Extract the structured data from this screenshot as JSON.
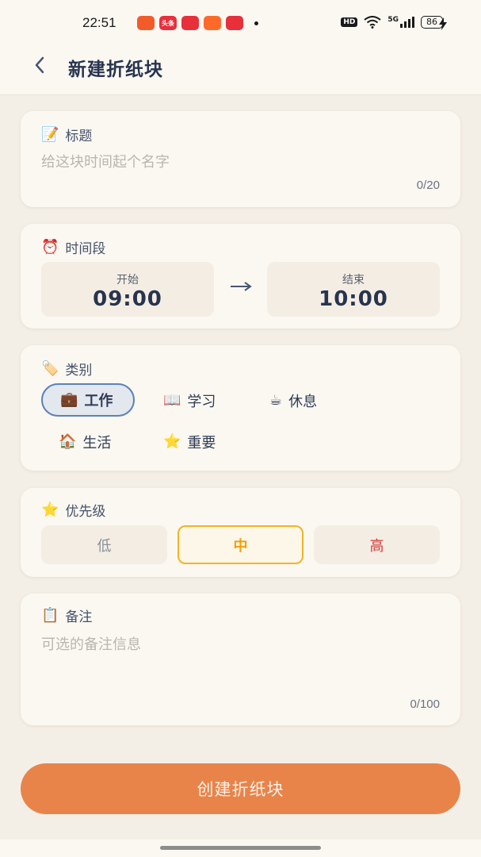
{
  "status_bar": {
    "time": "22:51",
    "app_icons": [
      {
        "name": "app-icon-1",
        "color": "#f25c2a"
      },
      {
        "name": "app-icon-toutiao",
        "color": "#e8303b",
        "text": "头条"
      },
      {
        "name": "app-icon-3",
        "color": "#e8303b"
      },
      {
        "name": "app-icon-4",
        "color": "#ff6a2b"
      },
      {
        "name": "app-icon-music",
        "color": "#e8303b"
      }
    ],
    "hd": "HD",
    "network": "5G",
    "battery": "86"
  },
  "header": {
    "title": "新建折纸块"
  },
  "title_section": {
    "icon": "📝",
    "label": "标题",
    "placeholder": "给这块时间起个名字",
    "counter": "0/20"
  },
  "time_section": {
    "icon": "⏰",
    "label": "时间段",
    "start_label": "开始",
    "start_value": "09:00",
    "end_label": "结束",
    "end_value": "10:00"
  },
  "category_section": {
    "icon": "🏷️",
    "label": "类别",
    "options": [
      {
        "icon": "💼",
        "label": "工作",
        "selected": true
      },
      {
        "icon": "📖",
        "label": "学习",
        "selected": false
      },
      {
        "icon": "☕",
        "label": "休息",
        "selected": false
      },
      {
        "icon": "🏠",
        "label": "生活",
        "selected": false
      },
      {
        "icon": "⭐",
        "label": "重要",
        "selected": false
      }
    ]
  },
  "priority_section": {
    "icon": "⭐",
    "label": "优先级",
    "options": [
      {
        "label": "低",
        "color": "#8a8f99",
        "selected": false
      },
      {
        "label": "中",
        "color": "#f0a00a",
        "selected": true
      },
      {
        "label": "高",
        "color": "#d83a3a",
        "selected": false
      }
    ]
  },
  "notes_section": {
    "icon": "📋",
    "label": "备注",
    "placeholder": "可选的备注信息",
    "counter": "0/100"
  },
  "create_button": {
    "label": "创建折纸块",
    "color": "#e8844a"
  }
}
